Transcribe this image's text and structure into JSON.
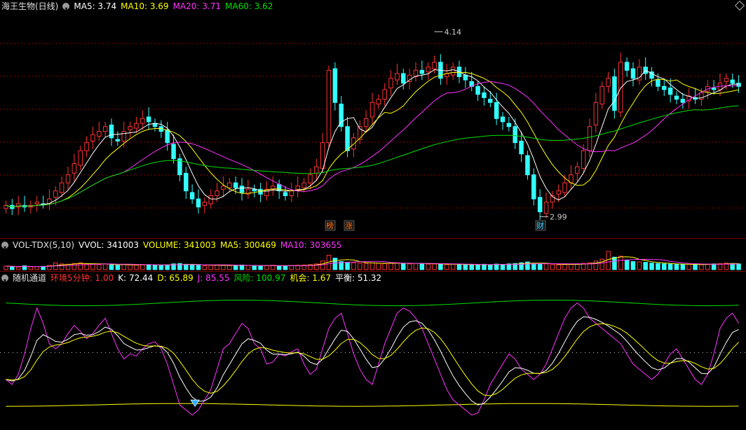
{
  "main": {
    "title": "海王生物(日线)",
    "ma_labels": [
      {
        "text": "MA5: 3.74",
        "color": "#ffffff"
      },
      {
        "text": "MA10: 3.69",
        "color": "#ffff00"
      },
      {
        "text": "MA20: 3.71",
        "color": "#ff33ff"
      },
      {
        "text": "MA60: 3.62",
        "color": "#00e000"
      }
    ],
    "high_label": "4.14",
    "low_label": "2.99",
    "tags": [
      {
        "text": "榜",
        "color": "#ff6600"
      },
      {
        "text": "涨",
        "color": "#ff6600"
      },
      {
        "text": "财",
        "color": "#33ccff"
      }
    ]
  },
  "vol": {
    "title": "VOL-TDX(5,10)",
    "labels": [
      {
        "text": "VVOL: 341003",
        "color": "#ffffff"
      },
      {
        "text": "VOLUME: 341003",
        "color": "#ffff00"
      },
      {
        "text": "MA5: 300469",
        "color": "#ffff00"
      },
      {
        "text": "MA10: 303655",
        "color": "#ff33ff"
      }
    ]
  },
  "ind": {
    "title": "随机通道",
    "labels": [
      {
        "text": "环境5分钟: 1.00",
        "color": "#ff3333"
      },
      {
        "text": "K: 72.44",
        "color": "#ffffff"
      },
      {
        "text": "D: 65.89",
        "color": "#ffff00"
      },
      {
        "text": "J: 85.55",
        "color": "#ff33ff"
      },
      {
        "text": "风险: 100.97",
        "color": "#00e000"
      },
      {
        "text": "机会: 1.67",
        "color": "#ffff00"
      },
      {
        "text": "平衡: 51.32",
        "color": "#ffffff"
      }
    ]
  },
  "colors": {
    "up": "#ff3333",
    "down": "#33ffff",
    "ma5": "#ffffff",
    "ma10": "#ffff00",
    "ma20": "#ff33ff",
    "ma60": "#00e000",
    "grid": "#8a0000"
  },
  "chart_data": {
    "type": "candlestick",
    "title": "海王生物(日线)",
    "xlabel": "",
    "ylabel": "",
    "ylim": [
      2.9,
      4.25
    ],
    "high": 4.14,
    "low": 2.99,
    "closes": [
      3.06,
      3.04,
      3.07,
      3.05,
      3.06,
      3.08,
      3.07,
      3.1,
      3.15,
      3.2,
      3.25,
      3.32,
      3.4,
      3.45,
      3.5,
      3.52,
      3.55,
      3.48,
      3.46,
      3.52,
      3.55,
      3.57,
      3.6,
      3.58,
      3.55,
      3.52,
      3.45,
      3.35,
      3.25,
      3.15,
      3.1,
      3.05,
      3.08,
      3.12,
      3.15,
      3.18,
      3.2,
      3.17,
      3.14,
      3.16,
      3.15,
      3.13,
      3.16,
      3.18,
      3.15,
      3.12,
      3.15,
      3.18,
      3.2,
      3.25,
      3.3,
      3.45,
      3.9,
      3.7,
      3.55,
      3.4,
      3.48,
      3.55,
      3.6,
      3.7,
      3.72,
      3.78,
      3.85,
      3.88,
      3.82,
      3.87,
      3.9,
      3.88,
      3.92,
      3.95,
      3.85,
      3.88,
      3.92,
      3.86,
      3.84,
      3.8,
      3.75,
      3.73,
      3.7,
      3.6,
      3.58,
      3.55,
      3.45,
      3.38,
      3.25,
      3.1,
      3.02,
      3.08,
      3.12,
      3.15,
      3.2,
      3.25,
      3.3,
      3.4,
      3.55,
      3.7,
      3.8,
      3.85,
      3.65,
      3.95,
      3.9,
      3.85,
      3.92,
      3.88,
      3.85,
      3.8,
      3.78,
      3.75,
      3.72,
      3.7,
      3.74,
      3.72,
      3.76,
      3.8,
      3.78,
      3.82,
      3.85,
      3.82,
      3.8
    ]
  },
  "vol_data": {
    "values": [
      1.8,
      1.6,
      1.4,
      2.0,
      1.5,
      1.6,
      1.7,
      2.2,
      3.5,
      3.0,
      2.8,
      3.2,
      3.6,
      3.0,
      2.8,
      2.6,
      2.9,
      2.4,
      2.2,
      2.8,
      2.5,
      2.4,
      2.7,
      2.6,
      2.3,
      2.1,
      2.5,
      3.0,
      3.2,
      2.8,
      2.4,
      2.2,
      2.0,
      2.3,
      2.5,
      2.2,
      2.1,
      2.0,
      2.4,
      2.2,
      2.0,
      1.8,
      2.1,
      2.3,
      2.0,
      1.9,
      2.1,
      2.3,
      2.4,
      2.6,
      3.0,
      4.5,
      7.5,
      6.0,
      4.2,
      3.8,
      3.6,
      3.4,
      3.2,
      3.5,
      3.3,
      3.1,
      3.4,
      3.6,
      3.2,
      3.0,
      3.3,
      3.1,
      2.9,
      3.0,
      2.8,
      2.7,
      2.9,
      2.6,
      2.5,
      2.4,
      2.6,
      2.8,
      2.5,
      2.9,
      2.7,
      3.0,
      3.2,
      3.6,
      4.0,
      3.2,
      2.8,
      3.0,
      2.6,
      2.5,
      2.7,
      2.9,
      3.0,
      3.3,
      3.6,
      4.5,
      5.5,
      9.5,
      6.5,
      7.0,
      5.0,
      4.2,
      4.0,
      3.8,
      3.4,
      3.2,
      3.0,
      2.9,
      2.7,
      2.6,
      2.8,
      2.7,
      2.6,
      2.9,
      3.0,
      3.1,
      3.4,
      3.2,
      3.0
    ]
  },
  "ind_data": {
    "J": [
      25,
      20,
      30,
      50,
      75,
      95,
      80,
      60,
      55,
      60,
      70,
      78,
      72,
      65,
      70,
      78,
      85,
      70,
      55,
      45,
      50,
      48,
      55,
      60,
      62,
      55,
      40,
      20,
      0,
      -5,
      -10,
      -5,
      5,
      15,
      35,
      55,
      60,
      70,
      80,
      75,
      60,
      55,
      40,
      42,
      50,
      48,
      52,
      55,
      40,
      30,
      35,
      55,
      75,
      85,
      90,
      70,
      50,
      35,
      25,
      20,
      40,
      60,
      75,
      90,
      95,
      92,
      85,
      75,
      60,
      45,
      30,
      15,
      5,
      0,
      -5,
      -10,
      -8,
      5,
      20,
      30,
      40,
      50,
      45,
      35,
      30,
      25,
      30,
      40,
      55,
      70,
      85,
      95,
      100,
      95,
      85,
      80,
      75,
      70,
      65,
      60,
      50,
      40,
      35,
      30,
      25,
      30,
      40,
      50,
      55,
      45,
      35,
      25,
      20,
      30,
      50,
      75,
      85,
      90,
      80
    ]
  }
}
